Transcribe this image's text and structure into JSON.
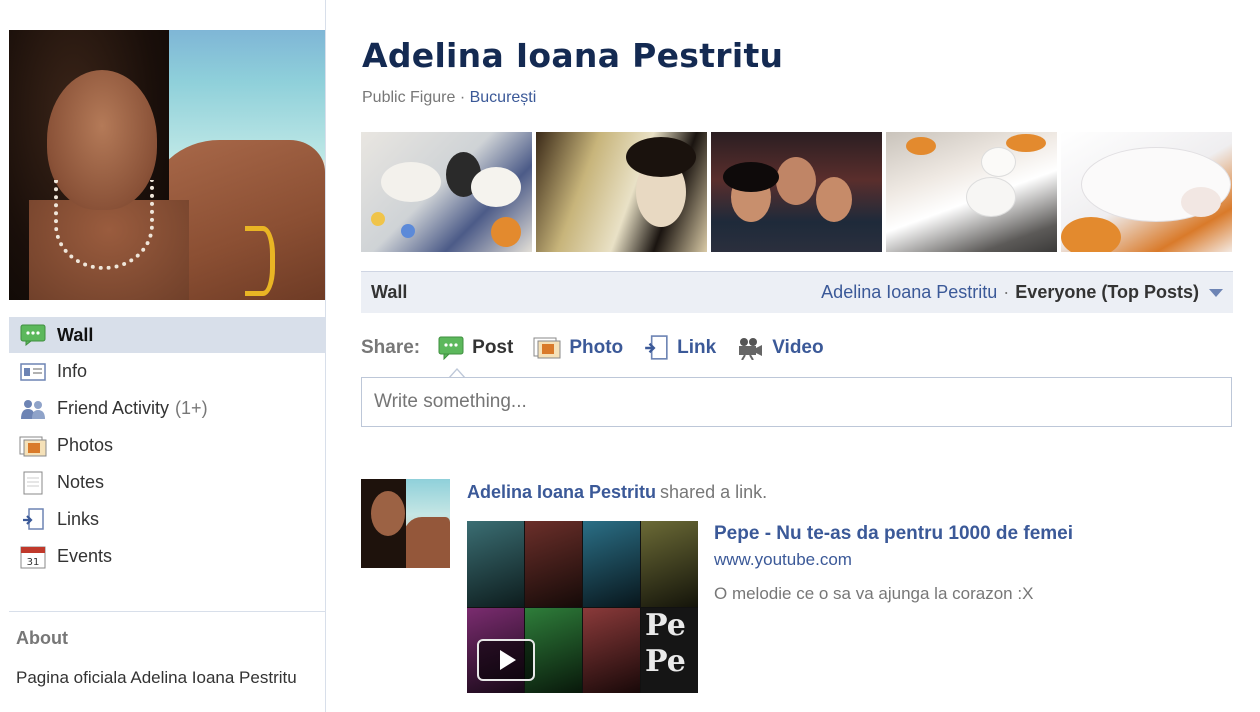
{
  "profile": {
    "name": "Adelina Ioana Pestritu",
    "category": "Public Figure",
    "separator": "·",
    "location": "București"
  },
  "nav": {
    "items": [
      {
        "label": "Wall",
        "icon": "wall-icon",
        "active": true
      },
      {
        "label": "Info",
        "icon": "info-icon"
      },
      {
        "label": "Friend Activity",
        "count": "(1+)",
        "icon": "friends-icon"
      },
      {
        "label": "Photos",
        "icon": "photos-icon"
      },
      {
        "label": "Notes",
        "icon": "notes-icon"
      },
      {
        "label": "Links",
        "icon": "links-icon"
      },
      {
        "label": "Events",
        "icon": "events-icon",
        "icon_text": "31"
      }
    ]
  },
  "about": {
    "title": "About",
    "text": "Pagina oficiala Adelina Ioana Pestritu"
  },
  "wall_bar": {
    "title": "Wall",
    "owner": "Adelina Ioana Pestritu",
    "separator": "·",
    "filter": "Everyone (Top Posts)"
  },
  "share": {
    "label": "Share:",
    "buttons": [
      {
        "label": "Post",
        "icon": "post-icon"
      },
      {
        "label": "Photo",
        "icon": "photo-icon"
      },
      {
        "label": "Link",
        "icon": "link-icon"
      },
      {
        "label": "Video",
        "icon": "video-icon"
      }
    ],
    "placeholder": "Write something..."
  },
  "story": {
    "actor": "Adelina Ioana Pestritu",
    "verb": "shared a link.",
    "link_title": "Pepe - Nu te-as da pentru 1000 de femei",
    "link_domain": "www.youtube.com",
    "link_description": "O melodie ce o sa va ajunga la corazon :X",
    "thumb_text_1": "Pe",
    "thumb_text_2": "Pe"
  },
  "colors": {
    "link": "#3b5998",
    "name": "#142a52",
    "nav_active_bg": "#d8dfea",
    "bar_bg": "#eceff5"
  }
}
